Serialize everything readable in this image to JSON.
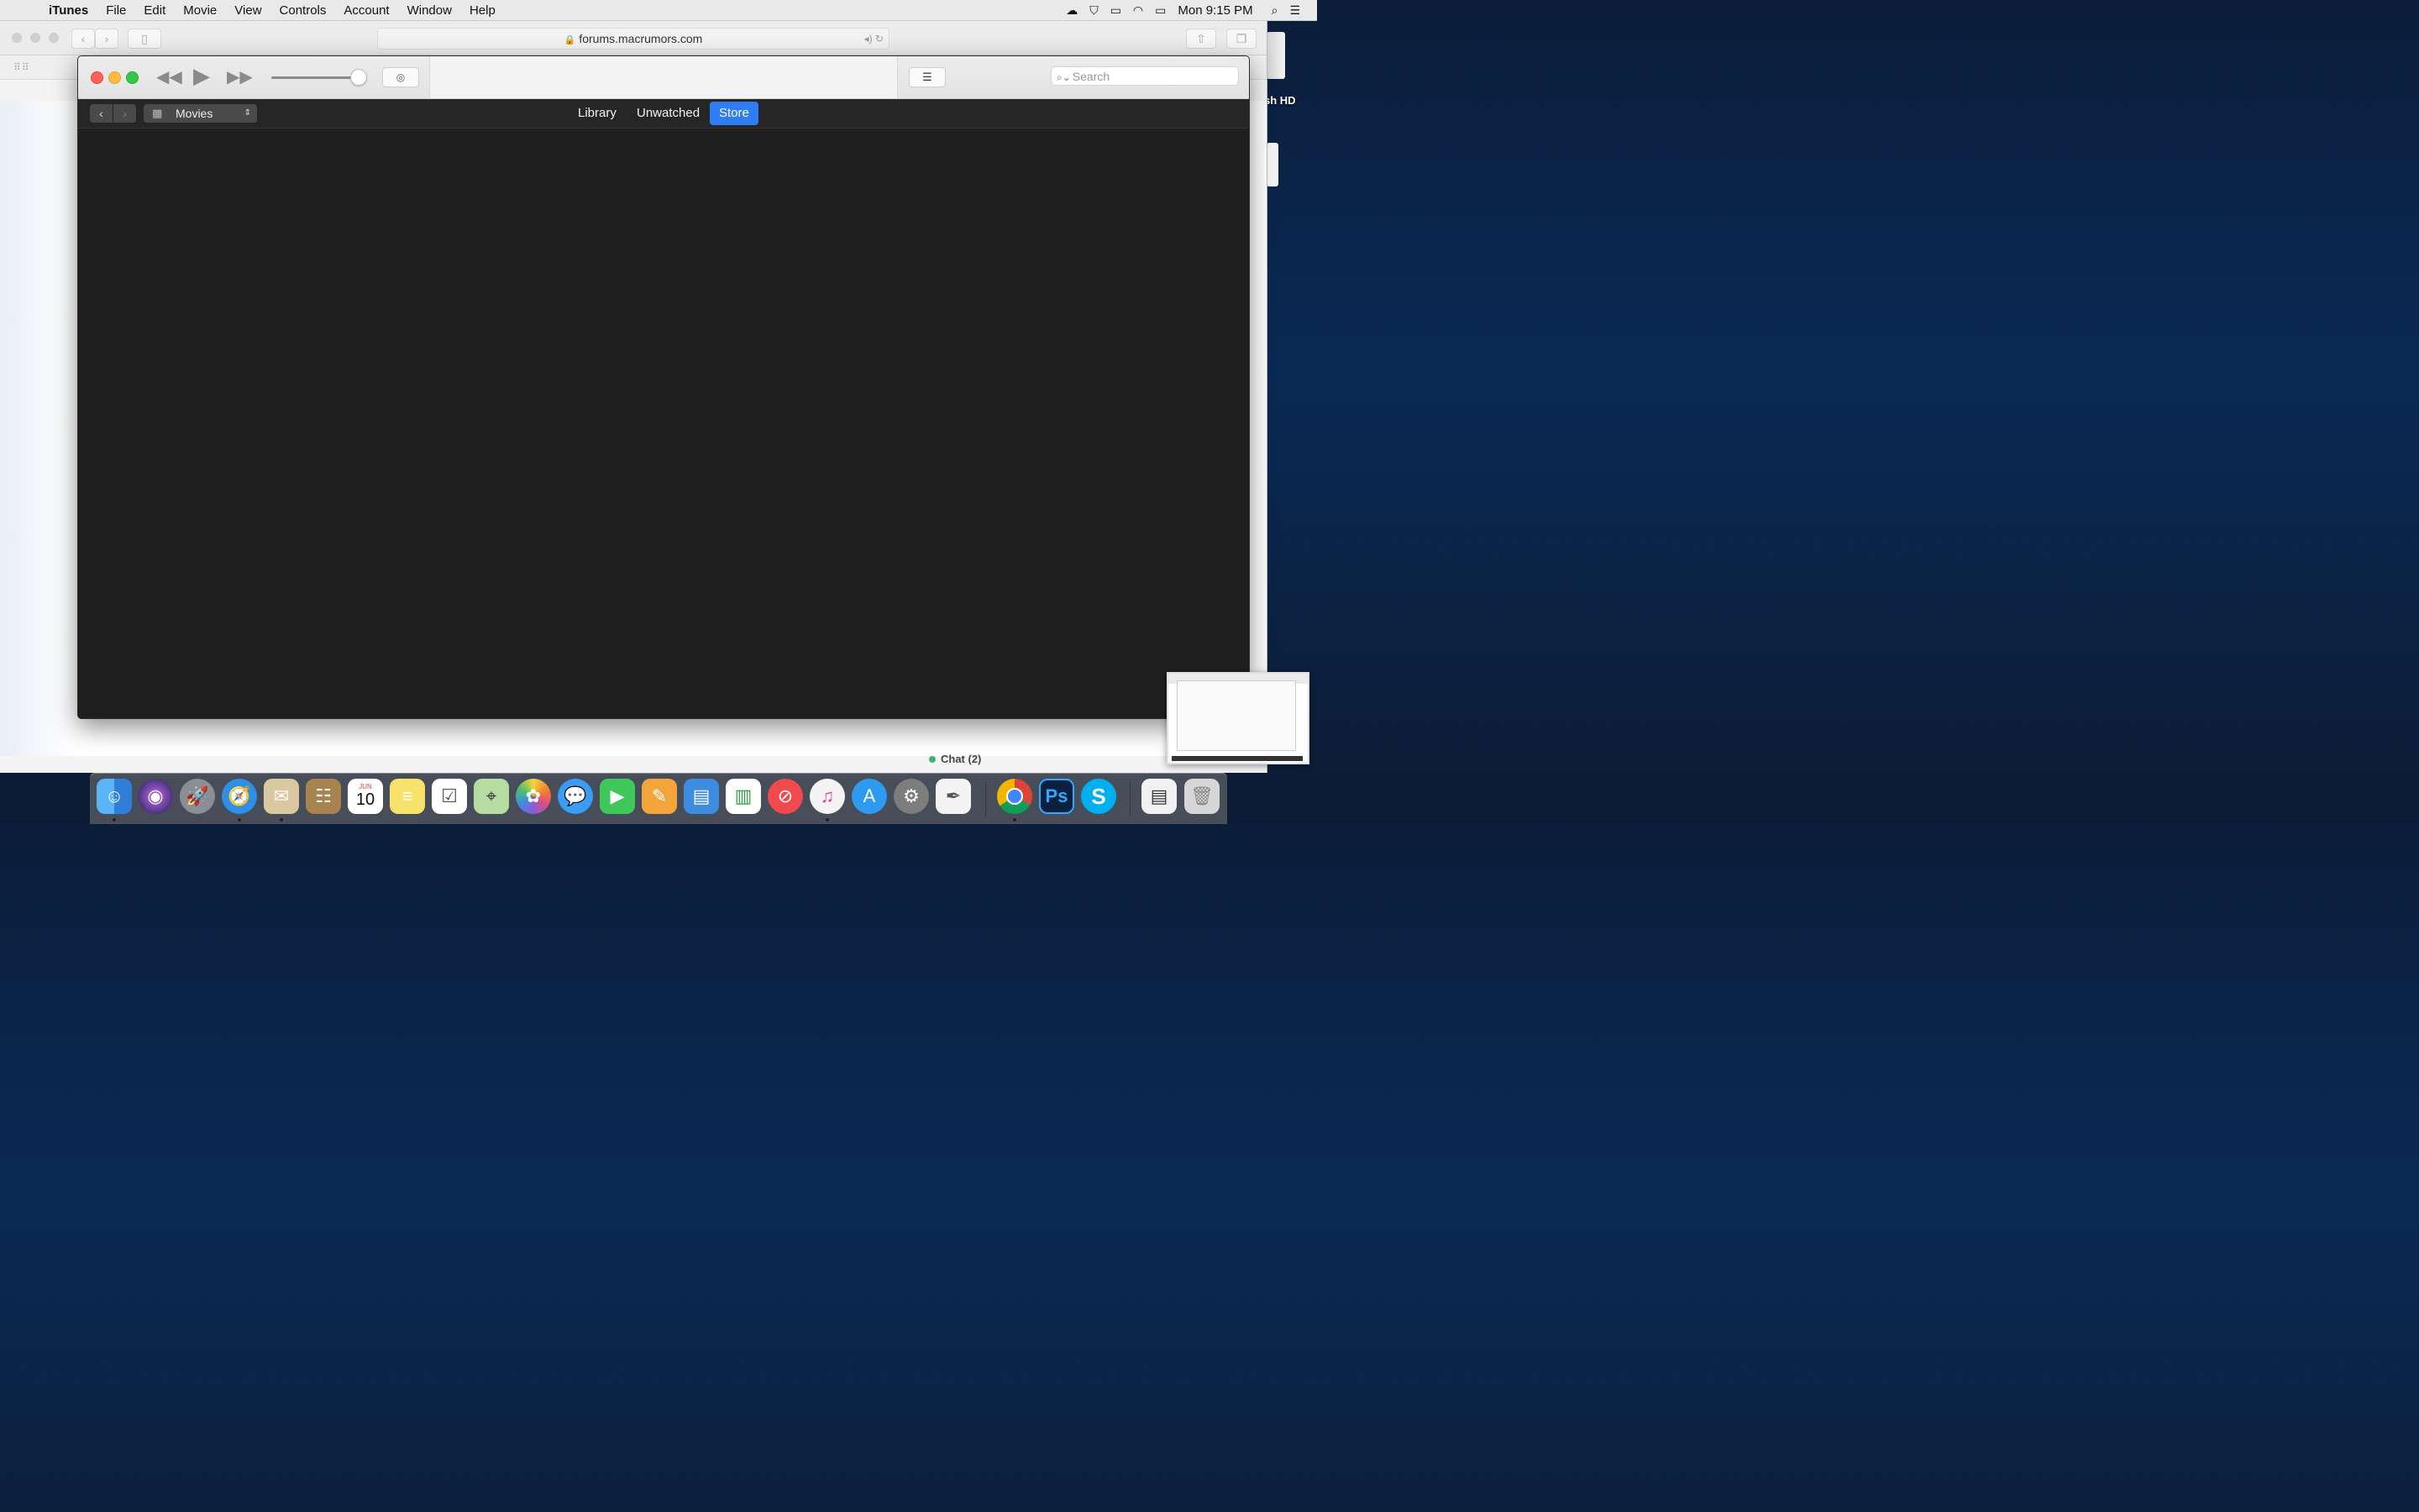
{
  "menubar": {
    "apple": "",
    "app_name": "iTunes",
    "items": [
      "File",
      "Edit",
      "Movie",
      "View",
      "Controls",
      "Account",
      "Window",
      "Help"
    ],
    "clock": "Mon 9:15 PM"
  },
  "safari": {
    "url": "forums.macrumors.com",
    "chat_label": "Chat (2)"
  },
  "desktop": {
    "drive_label": "sh HD"
  },
  "itunes": {
    "volume_level": 0.9,
    "search_placeholder": "Search",
    "media_kind": "Movies",
    "tabs": [
      "Library",
      "Unwatched",
      "Store"
    ],
    "active_tab": "Store",
    "accent_color": "#2e7cf6"
  },
  "dock": {
    "apps": [
      "Finder",
      "Siri",
      "Launchpad",
      "Safari",
      "Mail",
      "Contacts",
      "Calendar",
      "Notes",
      "Reminders",
      "Maps",
      "Photos",
      "Messages",
      "FaceTime",
      "Pages",
      "Keynote",
      "Numbers",
      "News",
      "iTunes",
      "App Store",
      "System Preferences",
      "TextEdit",
      "Chrome",
      "Photoshop",
      "Skype",
      "Preview",
      "Trash"
    ],
    "calendar_month": "JUN",
    "calendar_day": "10",
    "photoshop_label": "Ps",
    "skype_label": "S"
  }
}
